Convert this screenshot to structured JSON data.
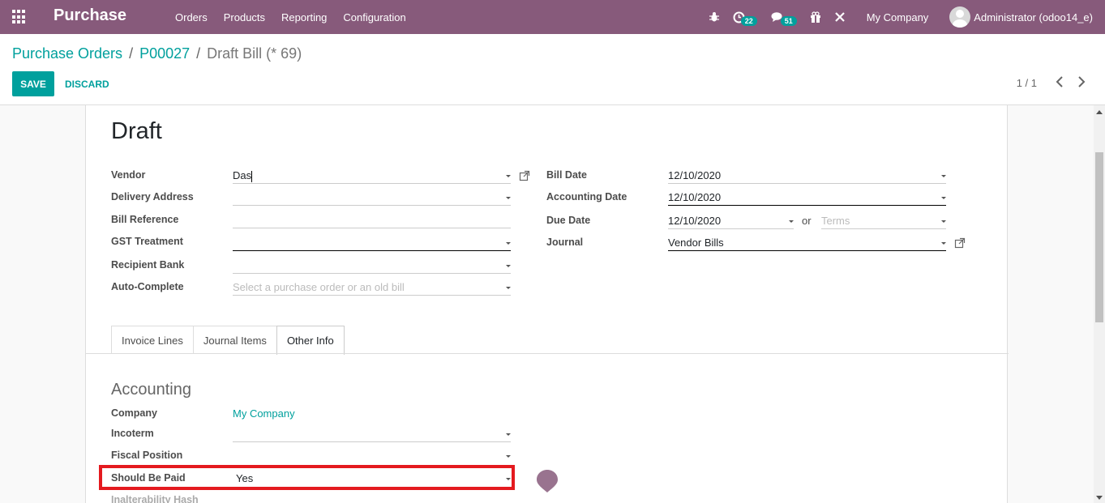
{
  "navbar": {
    "brand": "Purchase",
    "menu": [
      "Orders",
      "Products",
      "Reporting",
      "Configuration"
    ],
    "activity_count": "22",
    "message_count": "51",
    "company": "My Company",
    "user": "Administrator (odoo14_e)",
    "icons": [
      "apps-icon",
      "bug-icon",
      "clock-icon",
      "chat-icon",
      "gift-icon",
      "tools-icon"
    ]
  },
  "breadcrumb": {
    "level1": "Purchase Orders",
    "level2": "P00027",
    "sep": "/",
    "current": "Draft Bill (* 69)"
  },
  "buttons": {
    "save": "SAVE",
    "discard": "DISCARD"
  },
  "pager": {
    "value": "1 / 1"
  },
  "form": {
    "title": "Draft",
    "left": [
      {
        "label": "Vendor",
        "value": "Das",
        "dropdown": true
      },
      {
        "label": "Delivery Address",
        "value": "",
        "dropdown": true
      },
      {
        "label": "Bill Reference",
        "value": "",
        "dropdown": false
      },
      {
        "label": "GST Treatment",
        "value": "",
        "dropdown": true
      },
      {
        "label": "Recipient Bank",
        "value": "",
        "dropdown": true
      },
      {
        "label": "Auto-Complete",
        "value": "",
        "placeholder": "Select a purchase order or an old bill",
        "dropdown": true
      }
    ],
    "right": [
      {
        "label": "Bill Date",
        "value": "12/10/2020"
      },
      {
        "label": "Accounting Date",
        "value": "12/10/2020"
      },
      {
        "label": "Due Date",
        "value": "12/10/2020",
        "or": "or",
        "terms_placeholder": "Terms"
      },
      {
        "label": "Journal",
        "value": "Vendor Bills"
      }
    ]
  },
  "tabs": [
    {
      "label": "Invoice Lines",
      "active": false
    },
    {
      "label": "Journal Items",
      "active": false
    },
    {
      "label": "Other Info",
      "active": true
    }
  ],
  "other_info": {
    "section": "Accounting",
    "company_label": "Company",
    "company_value": "My Company",
    "incoterm_label": "Incoterm",
    "fiscal_label": "Fiscal Position",
    "should_be_paid_label": "Should Be Paid",
    "should_be_paid_value": "Yes",
    "inalterability_label": "Inalterability Hash"
  },
  "colors": {
    "navbar": "#875a7b",
    "accent": "#00a09d",
    "highlight": "#e41a1f"
  }
}
